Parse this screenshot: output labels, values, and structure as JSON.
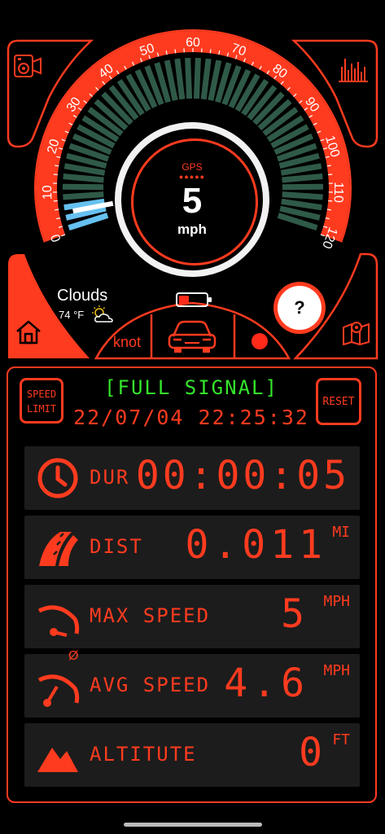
{
  "gauge": {
    "ticks": [
      "0",
      "10",
      "20",
      "30",
      "40",
      "50",
      "60",
      "70",
      "80",
      "90",
      "100",
      "110",
      "120"
    ],
    "gps_label": "GPS",
    "speed": "5",
    "speed_unit": "mph",
    "max_value": 120,
    "current_value": 5
  },
  "weather": {
    "condition": "Clouds",
    "temperature": "74 °F"
  },
  "controls": {
    "unit_button": "knot",
    "help_button": "?"
  },
  "panel": {
    "speed_limit_line1": "SPEED",
    "speed_limit_line2": "LIMIT",
    "signal_status": "[FULL SIGNAL]",
    "datetime": "22/07/04 22:25:32",
    "reset_label": "RESET"
  },
  "stats": [
    {
      "label": "DUR",
      "value": "00:00:05",
      "unit": ""
    },
    {
      "label": "DIST",
      "value": "0.011",
      "unit": "MI"
    },
    {
      "label": "MAX SPEED",
      "value": "5",
      "unit": "MPH"
    },
    {
      "label": "AVG SPEED",
      "value": "4.6",
      "unit": "MPH"
    },
    {
      "label": "ALTITUTE",
      "value": "0",
      "unit": "FT"
    }
  ],
  "avg_symbol": "Ø",
  "colors": {
    "accent": "#ff3b1f",
    "signal": "#35e62c",
    "card": "#1c1c1c",
    "gauge_bar": "#2f5a48"
  }
}
